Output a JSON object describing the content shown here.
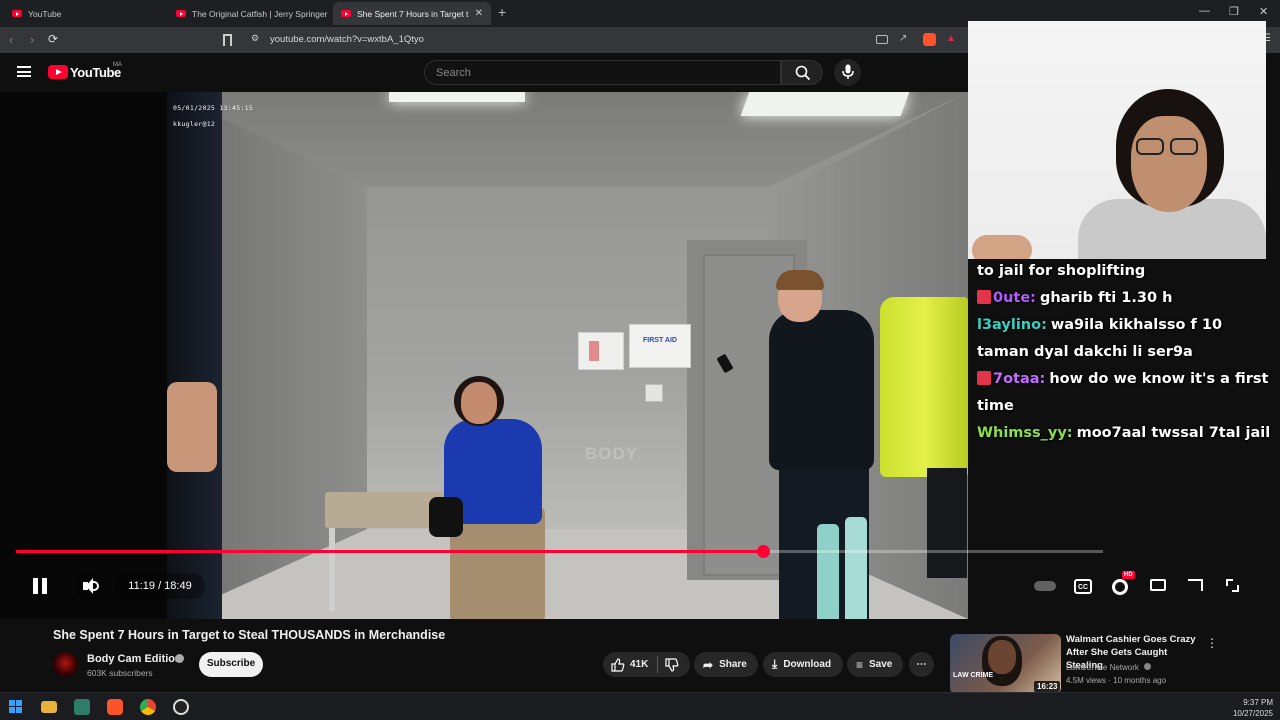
{
  "browser": {
    "tabs": [
      {
        "label": "YouTube"
      },
      {
        "label": "The Original Catfish | Jerry Springer"
      },
      {
        "label": "She Spent 7 Hours in Target t"
      }
    ],
    "new_tab": "+",
    "url": "youtube.com/watch?v=wxtbA_1Qtyo"
  },
  "youtube": {
    "logo_text": "YouTube",
    "country_code": "MA",
    "search_placeholder": "Search"
  },
  "video": {
    "timestamp_overlay": "05/01/2025 13:45:15",
    "user_overlay": "kkugler@12",
    "watermark": "BODY",
    "firstaid_label": "FIRST AID",
    "current_time": "11:19 / 18:49",
    "progress_fraction": 0.687,
    "hd_badge": "HD",
    "cc_label": "CC"
  },
  "chat": {
    "messages": [
      {
        "user": "",
        "text": "to jail for shoplifting",
        "color": "#ffffff"
      },
      {
        "user": "0ute:",
        "text": "gharib fti 1.30 h",
        "color": "#b05cff",
        "badge": true
      },
      {
        "user": "l3aylino:",
        "text": "wa9ila kikhalsso f 10 taman dyal dakchi li ser9a",
        "color": "#36d1c4"
      },
      {
        "user": "7otaa:",
        "text": "how do we know it's a first time",
        "color": "#c46bff",
        "badge": true
      },
      {
        "user": "Whimss_yy:",
        "text": "moo7aal twssal 7tal jail",
        "color": "#8be04e"
      }
    ]
  },
  "watch": {
    "title": "She Spent 7 Hours in Target to Steal THOUSANDS in Merchandise",
    "channel": "Body Cam Edition",
    "subscribers": "603K subscribers",
    "subscribe_label": "Subscribe",
    "likes": "41K",
    "share_label": "Share",
    "download_label": "Download",
    "save_label": "Save"
  },
  "recommended": {
    "title": "Walmart Cashier Goes Crazy After She Gets Caught Stealing",
    "channel": "Law&Crime Network",
    "meta": "4.5M views · 10 months ago",
    "duration": "16:23",
    "thumb_text": "LAW CRIME"
  },
  "taskbar": {
    "time": "9:37 PM",
    "date": "10/27/2025"
  },
  "colors": {
    "accent": "#ff0033",
    "background": "#0f0f0f"
  }
}
